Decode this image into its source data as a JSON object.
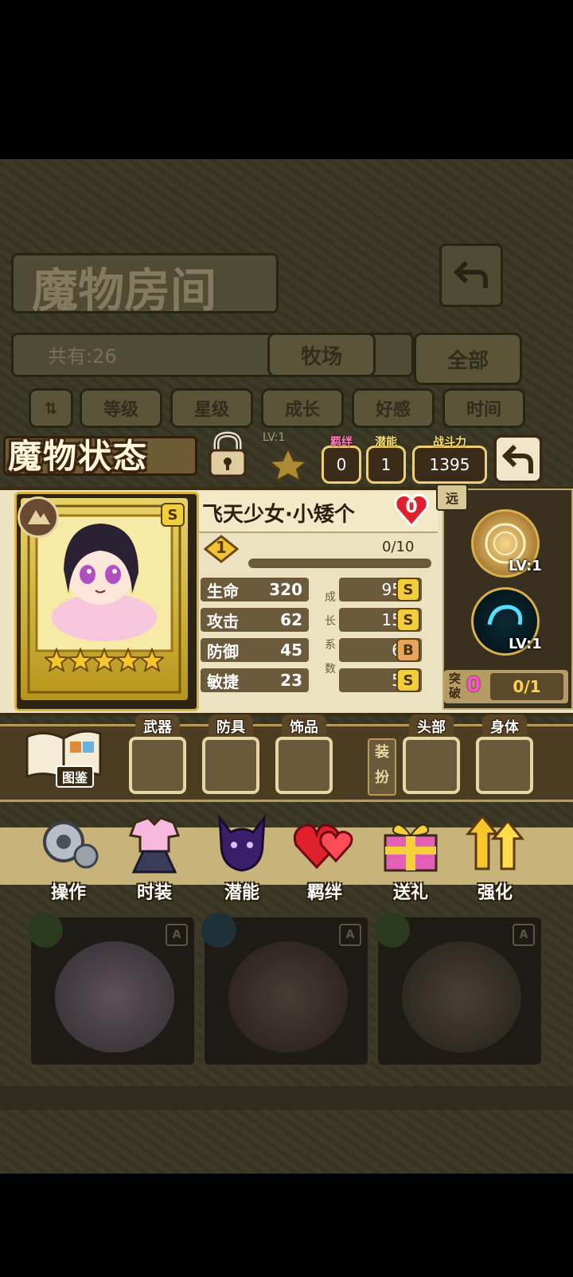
{
  "room": {
    "title": "魔物房间",
    "total_label": "共有:26",
    "tabs": [
      "牧场",
      "全部"
    ],
    "sort_buttons": [
      "等级",
      "星级",
      "成长",
      "好感",
      "时间"
    ]
  },
  "status": {
    "title": "魔物状态",
    "lv_text": "LV:1",
    "bond": {
      "label": "羁绊",
      "value": "0"
    },
    "potential": {
      "label": "潜能",
      "value": "1"
    },
    "power": {
      "label": "战斗力",
      "value": "1395"
    }
  },
  "monster": {
    "name": "飞天少女·小矮个",
    "affection": "0",
    "rank": "S",
    "stars": 5,
    "level": "1",
    "exp": "0/10",
    "exp_fraction": 0.0,
    "growth_label": [
      "成",
      "长",
      "系",
      "数"
    ],
    "stats": [
      {
        "name": "生命",
        "value": "320",
        "growth": "95.7",
        "grade": "S"
      },
      {
        "name": "攻击",
        "value": "62",
        "growth": "15.7",
        "grade": "S"
      },
      {
        "name": "防御",
        "value": "45",
        "growth": "6.9",
        "grade": "B"
      },
      {
        "name": "敏捷",
        "value": "23",
        "growth": "5.6",
        "grade": "S"
      }
    ]
  },
  "skills": {
    "range_tag": "远",
    "items": [
      {
        "lv": "LV:1"
      },
      {
        "lv": "LV:1"
      }
    ],
    "breakthrough": {
      "label_top": "突",
      "label_bottom": "破",
      "count": "0",
      "progress": "0/1"
    }
  },
  "equipment": {
    "codex_label": "图鉴",
    "slots_left": [
      "武器",
      "防具",
      "饰品"
    ],
    "dress_label": [
      "装",
      "扮"
    ],
    "slots_right": [
      "头部",
      "身体"
    ]
  },
  "actions": [
    "操作",
    "时装",
    "潜能",
    "羁绊",
    "送礼",
    "强化"
  ],
  "cards": [
    {
      "rank": "A"
    },
    {
      "rank": "A"
    },
    {
      "rank": "A"
    }
  ]
}
